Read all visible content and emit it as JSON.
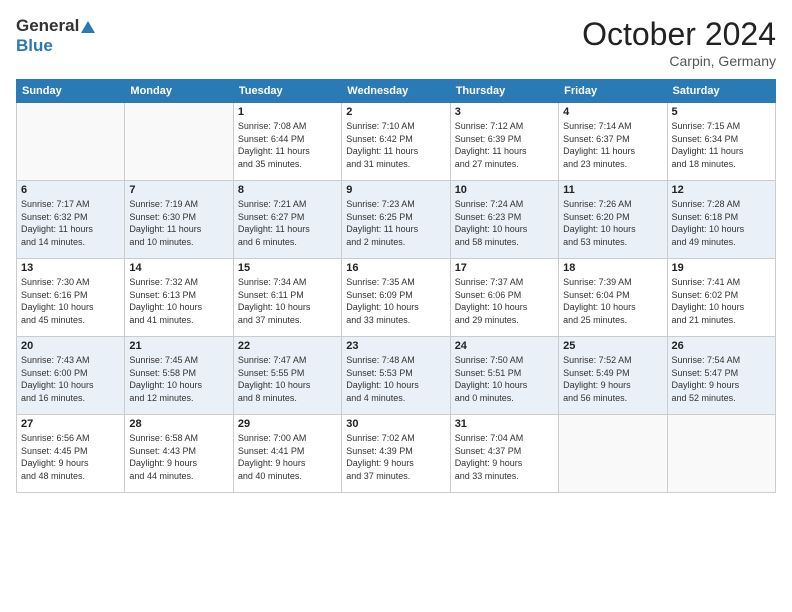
{
  "header": {
    "logo_line1": "General",
    "logo_line2": "Blue",
    "month": "October 2024",
    "location": "Carpin, Germany"
  },
  "days_of_week": [
    "Sunday",
    "Monday",
    "Tuesday",
    "Wednesday",
    "Thursday",
    "Friday",
    "Saturday"
  ],
  "weeks": [
    {
      "row_class": "row-even",
      "cells": [
        {
          "day": "",
          "info": "",
          "empty": true
        },
        {
          "day": "",
          "info": "",
          "empty": true
        },
        {
          "day": "1",
          "info": "Sunrise: 7:08 AM\nSunset: 6:44 PM\nDaylight: 11 hours\nand 35 minutes."
        },
        {
          "day": "2",
          "info": "Sunrise: 7:10 AM\nSunset: 6:42 PM\nDaylight: 11 hours\nand 31 minutes."
        },
        {
          "day": "3",
          "info": "Sunrise: 7:12 AM\nSunset: 6:39 PM\nDaylight: 11 hours\nand 27 minutes."
        },
        {
          "day": "4",
          "info": "Sunrise: 7:14 AM\nSunset: 6:37 PM\nDaylight: 11 hours\nand 23 minutes."
        },
        {
          "day": "5",
          "info": "Sunrise: 7:15 AM\nSunset: 6:34 PM\nDaylight: 11 hours\nand 18 minutes."
        }
      ]
    },
    {
      "row_class": "row-odd",
      "cells": [
        {
          "day": "6",
          "info": "Sunrise: 7:17 AM\nSunset: 6:32 PM\nDaylight: 11 hours\nand 14 minutes."
        },
        {
          "day": "7",
          "info": "Sunrise: 7:19 AM\nSunset: 6:30 PM\nDaylight: 11 hours\nand 10 minutes."
        },
        {
          "day": "8",
          "info": "Sunrise: 7:21 AM\nSunset: 6:27 PM\nDaylight: 11 hours\nand 6 minutes."
        },
        {
          "day": "9",
          "info": "Sunrise: 7:23 AM\nSunset: 6:25 PM\nDaylight: 11 hours\nand 2 minutes."
        },
        {
          "day": "10",
          "info": "Sunrise: 7:24 AM\nSunset: 6:23 PM\nDaylight: 10 hours\nand 58 minutes."
        },
        {
          "day": "11",
          "info": "Sunrise: 7:26 AM\nSunset: 6:20 PM\nDaylight: 10 hours\nand 53 minutes."
        },
        {
          "day": "12",
          "info": "Sunrise: 7:28 AM\nSunset: 6:18 PM\nDaylight: 10 hours\nand 49 minutes."
        }
      ]
    },
    {
      "row_class": "row-even",
      "cells": [
        {
          "day": "13",
          "info": "Sunrise: 7:30 AM\nSunset: 6:16 PM\nDaylight: 10 hours\nand 45 minutes."
        },
        {
          "day": "14",
          "info": "Sunrise: 7:32 AM\nSunset: 6:13 PM\nDaylight: 10 hours\nand 41 minutes."
        },
        {
          "day": "15",
          "info": "Sunrise: 7:34 AM\nSunset: 6:11 PM\nDaylight: 10 hours\nand 37 minutes."
        },
        {
          "day": "16",
          "info": "Sunrise: 7:35 AM\nSunset: 6:09 PM\nDaylight: 10 hours\nand 33 minutes."
        },
        {
          "day": "17",
          "info": "Sunrise: 7:37 AM\nSunset: 6:06 PM\nDaylight: 10 hours\nand 29 minutes."
        },
        {
          "day": "18",
          "info": "Sunrise: 7:39 AM\nSunset: 6:04 PM\nDaylight: 10 hours\nand 25 minutes."
        },
        {
          "day": "19",
          "info": "Sunrise: 7:41 AM\nSunset: 6:02 PM\nDaylight: 10 hours\nand 21 minutes."
        }
      ]
    },
    {
      "row_class": "row-odd",
      "cells": [
        {
          "day": "20",
          "info": "Sunrise: 7:43 AM\nSunset: 6:00 PM\nDaylight: 10 hours\nand 16 minutes."
        },
        {
          "day": "21",
          "info": "Sunrise: 7:45 AM\nSunset: 5:58 PM\nDaylight: 10 hours\nand 12 minutes."
        },
        {
          "day": "22",
          "info": "Sunrise: 7:47 AM\nSunset: 5:55 PM\nDaylight: 10 hours\nand 8 minutes."
        },
        {
          "day": "23",
          "info": "Sunrise: 7:48 AM\nSunset: 5:53 PM\nDaylight: 10 hours\nand 4 minutes."
        },
        {
          "day": "24",
          "info": "Sunrise: 7:50 AM\nSunset: 5:51 PM\nDaylight: 10 hours\nand 0 minutes."
        },
        {
          "day": "25",
          "info": "Sunrise: 7:52 AM\nSunset: 5:49 PM\nDaylight: 9 hours\nand 56 minutes."
        },
        {
          "day": "26",
          "info": "Sunrise: 7:54 AM\nSunset: 5:47 PM\nDaylight: 9 hours\nand 52 minutes."
        }
      ]
    },
    {
      "row_class": "row-even",
      "cells": [
        {
          "day": "27",
          "info": "Sunrise: 6:56 AM\nSunset: 4:45 PM\nDaylight: 9 hours\nand 48 minutes."
        },
        {
          "day": "28",
          "info": "Sunrise: 6:58 AM\nSunset: 4:43 PM\nDaylight: 9 hours\nand 44 minutes."
        },
        {
          "day": "29",
          "info": "Sunrise: 7:00 AM\nSunset: 4:41 PM\nDaylight: 9 hours\nand 40 minutes."
        },
        {
          "day": "30",
          "info": "Sunrise: 7:02 AM\nSunset: 4:39 PM\nDaylight: 9 hours\nand 37 minutes."
        },
        {
          "day": "31",
          "info": "Sunrise: 7:04 AM\nSunset: 4:37 PM\nDaylight: 9 hours\nand 33 minutes."
        },
        {
          "day": "",
          "info": "",
          "empty": true
        },
        {
          "day": "",
          "info": "",
          "empty": true
        }
      ]
    }
  ]
}
